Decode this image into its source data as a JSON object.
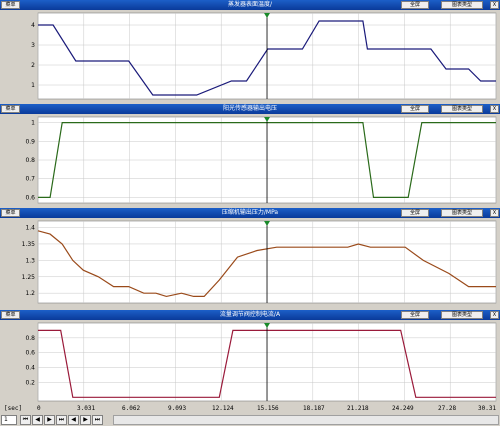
{
  "panels": [
    {
      "title": "蒸发器表面温度/",
      "left_btn": "菜单",
      "full_btn": "全屏",
      "type_btn": "图表类型",
      "close": "X",
      "yticks": [
        4,
        3,
        2,
        1
      ],
      "ylim": [
        0.3,
        4.6
      ],
      "color": "#1a1a7a"
    },
    {
      "title": "阳光传感器输出电压",
      "left_btn": "菜单",
      "full_btn": "全屏",
      "type_btn": "图表类型",
      "close": "X",
      "yticks": [
        0.6,
        0.7,
        0.8,
        0.9,
        1
      ],
      "ylim": [
        0.57,
        1.03
      ],
      "color": "#2a6a1a"
    },
    {
      "title": "压缩机输出压力/MPa",
      "left_btn": "菜单",
      "full_btn": "全屏",
      "type_btn": "图表类型",
      "close": "X",
      "yticks": [
        1.4,
        1.35,
        1.3,
        1.25,
        1.2
      ],
      "ylim": [
        1.17,
        1.42
      ],
      "color": "#9a4a1a"
    },
    {
      "title": "流量调节阀控制电流/A",
      "left_btn": "菜单",
      "full_btn": "全屏",
      "type_btn": "图表类型",
      "close": "X",
      "yticks": [
        0.8,
        0.6,
        0.4,
        0.2
      ],
      "ylim": [
        -0.05,
        1.0
      ],
      "color": "#9a1a3a"
    }
  ],
  "chart_data": [
    {
      "type": "line",
      "title": "蒸发器表面温度/",
      "xlim": [
        0,
        30.31
      ],
      "x": [
        0,
        1.0,
        2.5,
        6.0,
        7.6,
        10.5,
        12.8,
        13.8,
        15.2,
        17.5,
        18.6,
        21.5,
        21.8,
        24.5,
        26.0,
        27.0,
        28.5,
        29.3,
        30.31
      ],
      "values": [
        4,
        4,
        2.2,
        2.2,
        0.5,
        0.5,
        1.2,
        1.2,
        2.8,
        2.8,
        4.2,
        4.2,
        2.8,
        2.8,
        2.8,
        1.8,
        1.8,
        1.2,
        1.2
      ],
      "ylim": [
        0.3,
        4.6
      ],
      "xlabel": "[sec]"
    },
    {
      "type": "line",
      "title": "阳光传感器输出电压",
      "xlim": [
        0,
        30.31
      ],
      "x": [
        0,
        0.8,
        1.6,
        21.5,
        22.2,
        24.5,
        25.4,
        30.31
      ],
      "values": [
        0.6,
        0.6,
        1.0,
        1.0,
        0.6,
        0.6,
        1.0,
        1.0
      ],
      "ylim": [
        0.57,
        1.03
      ],
      "xlabel": "[sec]"
    },
    {
      "type": "line",
      "title": "压缩机输出压力/MPa",
      "xlim": [
        0,
        30.31
      ],
      "x": [
        0,
        0.8,
        1.6,
        2.3,
        3.0,
        4.0,
        5.0,
        6.0,
        7.0,
        7.8,
        8.5,
        9.5,
        10.3,
        11.0,
        12.0,
        13.2,
        14.5,
        15.8,
        17.0,
        19.0,
        20.5,
        21.2,
        22.0,
        23.0,
        24.3,
        25.5,
        27.2,
        28.5,
        30.31
      ],
      "values": [
        1.39,
        1.38,
        1.35,
        1.3,
        1.27,
        1.25,
        1.22,
        1.22,
        1.2,
        1.2,
        1.19,
        1.2,
        1.19,
        1.19,
        1.24,
        1.31,
        1.33,
        1.34,
        1.34,
        1.34,
        1.34,
        1.35,
        1.34,
        1.34,
        1.34,
        1.3,
        1.26,
        1.22,
        1.22
      ],
      "ylim": [
        1.17,
        1.42
      ],
      "xlabel": "[sec]"
    },
    {
      "type": "line",
      "title": "流量调节阀控制电流/A",
      "xlim": [
        0,
        30.31
      ],
      "x": [
        0,
        1.5,
        2.3,
        12.0,
        12.9,
        15.2,
        24.0,
        25.0,
        30.31
      ],
      "values": [
        0.9,
        0.9,
        0,
        0,
        0.9,
        0.9,
        0.9,
        0,
        0
      ],
      "ylim": [
        -0.05,
        1.0
      ],
      "xlabel": "[sec]"
    }
  ],
  "cursor_x": 15.156,
  "time_axis": {
    "unit": "[sec]",
    "labels": [
      "0",
      "3.031",
      "6.062",
      "9.093",
      "12.124",
      "15.156",
      "18.187",
      "21.218",
      "24.249",
      "27.28",
      "30.31"
    ]
  },
  "controls": {
    "zoom_value": "1",
    "buttons": [
      "⏮",
      "◀",
      "▶",
      "⏭",
      "◀",
      "▶",
      "⏭"
    ]
  },
  "colors": {
    "grid": "#c8c8c8",
    "cursor": "#000000",
    "marker": "#1a8a2a",
    "header": "#1a4fb0",
    "plot_bg": "#ffffff"
  }
}
